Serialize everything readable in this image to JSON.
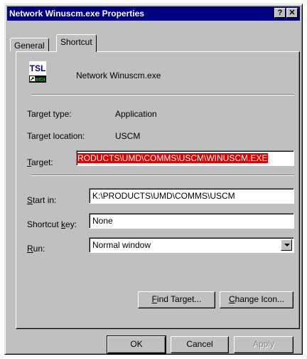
{
  "window": {
    "title": "Network Winuscm.exe Properties",
    "help_button": "?",
    "close_button": "✕"
  },
  "tabs": {
    "general": "General",
    "shortcut": "Shortcut"
  },
  "app": {
    "name": "Network Winuscm.exe",
    "icon_text": "TSL",
    "icon_subtext": "IMDI"
  },
  "info": {
    "target_type_label": "Target type:",
    "target_type_value": "Application",
    "target_location_label": "Target location:",
    "target_location_value": "USCM"
  },
  "target": {
    "label_first": "T",
    "label_rest": "arget:",
    "value": "RODUCTS\\UMD\\COMMS\\USCM\\WINUSCM.EXE"
  },
  "start_in": {
    "label_first": "S",
    "label_rest": "tart in:",
    "value": "K:\\PRODUCTS\\UMD\\COMMS\\USCM"
  },
  "shortcut_key": {
    "label_pre": "Shortcut ",
    "label_u": "k",
    "label_post": "ey:",
    "value": "None"
  },
  "run": {
    "label_first": "R",
    "label_rest": "un:",
    "value": "Normal window"
  },
  "buttons": {
    "find_target_u": "F",
    "find_target_rest": "ind Target...",
    "change_icon_u": "C",
    "change_icon_rest": "hange Icon...",
    "ok": "OK",
    "cancel": "Cancel",
    "apply": "Apply"
  },
  "colors": {
    "titlebar": "#000080",
    "selection": "#e00000",
    "face": "#c0c0c0"
  }
}
